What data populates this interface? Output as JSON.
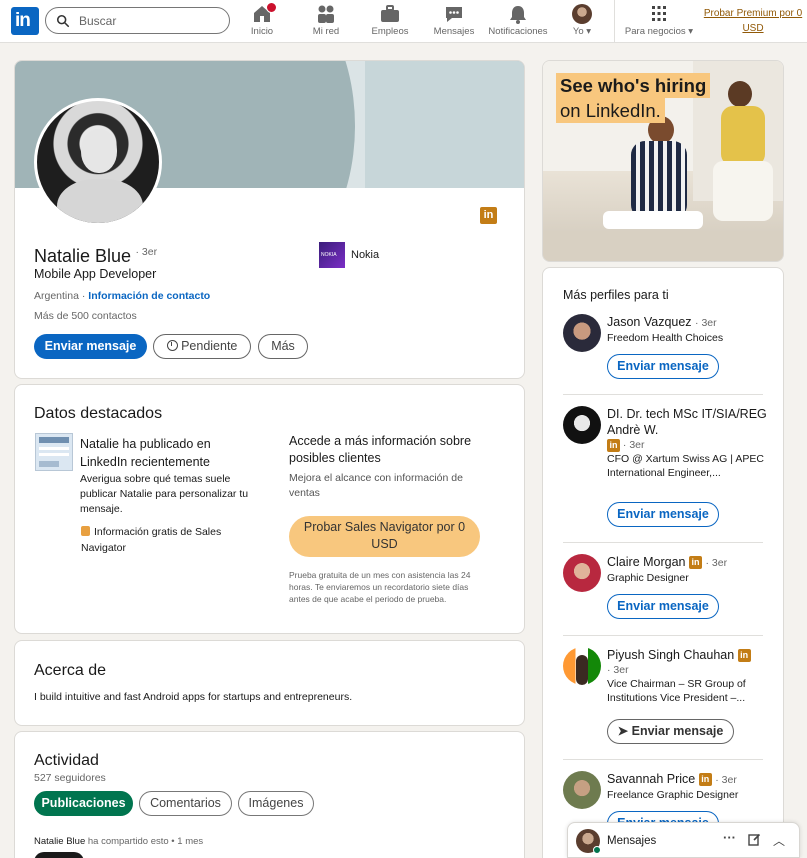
{
  "nav": {
    "logo_text": "in",
    "search_placeholder": "Buscar",
    "items": [
      {
        "label": "Inicio",
        "icon": "home-icon"
      },
      {
        "label": "Mi red",
        "icon": "network-icon"
      },
      {
        "label": "Empleos",
        "icon": "briefcase-icon"
      },
      {
        "label": "Mensajes",
        "icon": "messaging-icon"
      },
      {
        "label": "Notificaciones",
        "icon": "bell-icon"
      },
      {
        "label": "Yo",
        "icon": "me-avatar"
      },
      {
        "label": "Para negocios",
        "icon": "grid-icon"
      }
    ],
    "premium": "Probar Premium por 0 USD"
  },
  "profile": {
    "name": "Natalie Blue",
    "degree": "· 3er",
    "headline": "Mobile App Developer",
    "location": "Argentina",
    "separator": "·",
    "contact_link": "Información de contacto",
    "connections": "Más de 500 contactos",
    "company": "Nokia",
    "company_logo_text": "NOKIA",
    "buttons": {
      "message": "Enviar mensaje",
      "pending": "Pendiente",
      "more": "Más"
    }
  },
  "highlights": {
    "title": "Datos destacados",
    "post_title": "Natalie ha publicado en LinkedIn recientemente",
    "post_desc": "Averigua sobre qué temas suele publicar Natalie para personalizar tu mensaje.",
    "sales_info": "Información gratis de Sales Navigator",
    "upsell_title": "Accede a más información sobre posibles clientes",
    "upsell_desc": "Mejora el alcance con información de ventas",
    "upsell_button": "Probar Sales Navigator por 0 USD",
    "upsell_fine": "Prueba gratuita de un mes con asistencia las 24 horas. Te enviaremos un recordatorio siete días antes de que acabe el periodo de prueba."
  },
  "about": {
    "title": "Acerca de",
    "text": "I build intuitive and fast Android apps for startups and entrepreneurs."
  },
  "activity": {
    "title": "Actividad",
    "followers": "527 seguidores",
    "tabs": [
      "Publicaciones",
      "Comentarios",
      "Imágenes"
    ],
    "post_author": "Natalie Blue",
    "post_meta": "ha compartido esto • 1 mes"
  },
  "ad": {
    "line1": "See who's hiring",
    "line2": "on LinkedIn."
  },
  "more_profiles": {
    "title": "Más perfiles para ti",
    "people": [
      {
        "name": "Jason Vazquez",
        "degree": "· 3er",
        "headline": "Freedom Health Choices",
        "button": "Enviar mensaje"
      },
      {
        "name": "DI. Dr. tech MSc IT/SIA/REG Andrè W.",
        "degree": "· 3er",
        "headline": "CFO @ Xartum Swiss AG | APEC International Engineer,...",
        "button": "Enviar mensaje"
      },
      {
        "name": "Claire Morgan",
        "degree": "· 3er",
        "headline": "Graphic Designer",
        "button": "Enviar mensaje"
      },
      {
        "name": "Piyush Singh Chauhan",
        "degree": "· 3er",
        "headline": "Vice Chairman – SR Group of Institutions Vice President –...",
        "button": "Enviar mensaje"
      },
      {
        "name": "Savannah Price",
        "degree": "· 3er",
        "headline": "Freelance Graphic Designer",
        "button": "Enviar mensaje"
      }
    ]
  },
  "messaging": {
    "label": "Mensajes"
  },
  "colors": {
    "brand_blue": "#0a66c2",
    "premium_gold": "#c37d16",
    "activity_green": "#01754f"
  }
}
